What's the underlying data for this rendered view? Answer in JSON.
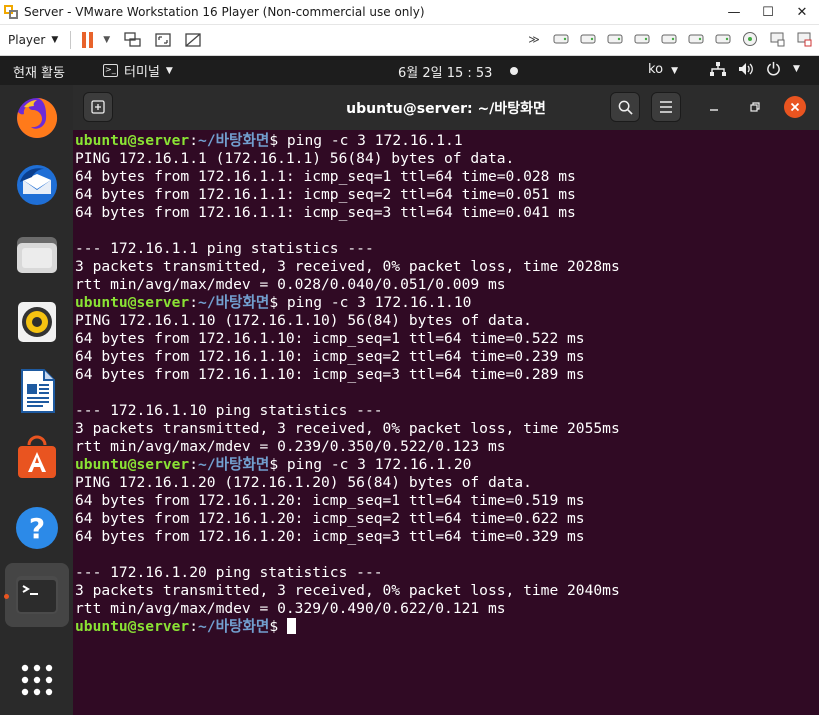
{
  "vmware": {
    "title": "Server - VMware Workstation 16 Player (Non-commercial use only)",
    "player_label": "Player",
    "window_controls": {
      "minimize": "—",
      "maximize": "☐",
      "close": "✕"
    }
  },
  "gnome": {
    "activities": "현재 활동",
    "app_menu": "터미널",
    "clock": "6월 2일  15 : 53",
    "input_method": "ko"
  },
  "dock": {
    "items": [
      "firefox-icon",
      "thunderbird-icon",
      "files-icon",
      "rhythmbox-icon",
      "libreoffice-writer-icon",
      "software-center-icon",
      "help-icon",
      "terminal-icon",
      "show-apps-icon"
    ],
    "active_index": 7
  },
  "terminal": {
    "title": "ubuntu@server: ~/바탕화면",
    "prompt": {
      "user": "ubuntu@server",
      "colon": ":",
      "path": "~/바탕화면",
      "symbol": "$ "
    },
    "lines": [
      {
        "type": "cmd",
        "text": "ping -c 3 172.16.1.1"
      },
      {
        "type": "out",
        "text": "PING 172.16.1.1 (172.16.1.1) 56(84) bytes of data."
      },
      {
        "type": "out",
        "text": "64 bytes from 172.16.1.1: icmp_seq=1 ttl=64 time=0.028 ms"
      },
      {
        "type": "out",
        "text": "64 bytes from 172.16.1.1: icmp_seq=2 ttl=64 time=0.051 ms"
      },
      {
        "type": "out",
        "text": "64 bytes from 172.16.1.1: icmp_seq=3 ttl=64 time=0.041 ms"
      },
      {
        "type": "out",
        "text": ""
      },
      {
        "type": "out",
        "text": "--- 172.16.1.1 ping statistics ---"
      },
      {
        "type": "out",
        "text": "3 packets transmitted, 3 received, 0% packet loss, time 2028ms"
      },
      {
        "type": "out",
        "text": "rtt min/avg/max/mdev = 0.028/0.040/0.051/0.009 ms"
      },
      {
        "type": "cmd",
        "text": "ping -c 3 172.16.1.10"
      },
      {
        "type": "out",
        "text": "PING 172.16.1.10 (172.16.1.10) 56(84) bytes of data."
      },
      {
        "type": "out",
        "text": "64 bytes from 172.16.1.10: icmp_seq=1 ttl=64 time=0.522 ms"
      },
      {
        "type": "out",
        "text": "64 bytes from 172.16.1.10: icmp_seq=2 ttl=64 time=0.239 ms"
      },
      {
        "type": "out",
        "text": "64 bytes from 172.16.1.10: icmp_seq=3 ttl=64 time=0.289 ms"
      },
      {
        "type": "out",
        "text": ""
      },
      {
        "type": "out",
        "text": "--- 172.16.1.10 ping statistics ---"
      },
      {
        "type": "out",
        "text": "3 packets transmitted, 3 received, 0% packet loss, time 2055ms"
      },
      {
        "type": "out",
        "text": "rtt min/avg/max/mdev = 0.239/0.350/0.522/0.123 ms"
      },
      {
        "type": "cmd",
        "text": "ping -c 3 172.16.1.20"
      },
      {
        "type": "out",
        "text": "PING 172.16.1.20 (172.16.1.20) 56(84) bytes of data."
      },
      {
        "type": "out",
        "text": "64 bytes from 172.16.1.20: icmp_seq=1 ttl=64 time=0.519 ms"
      },
      {
        "type": "out",
        "text": "64 bytes from 172.16.1.20: icmp_seq=2 ttl=64 time=0.622 ms"
      },
      {
        "type": "out",
        "text": "64 bytes from 172.16.1.20: icmp_seq=3 ttl=64 time=0.329 ms"
      },
      {
        "type": "out",
        "text": ""
      },
      {
        "type": "out",
        "text": "--- 172.16.1.20 ping statistics ---"
      },
      {
        "type": "out",
        "text": "3 packets transmitted, 3 received, 0% packet loss, time 2040ms"
      },
      {
        "type": "out",
        "text": "rtt min/avg/max/mdev = 0.329/0.490/0.622/0.121 ms"
      },
      {
        "type": "cmd",
        "text": "",
        "cursor": true
      }
    ]
  },
  "colors": {
    "terminal_bg": "#300a24",
    "prompt_user": "#8ae234",
    "prompt_path": "#729fcf",
    "ubuntu_orange": "#e95420",
    "vmware_pause": "#e8632b"
  }
}
